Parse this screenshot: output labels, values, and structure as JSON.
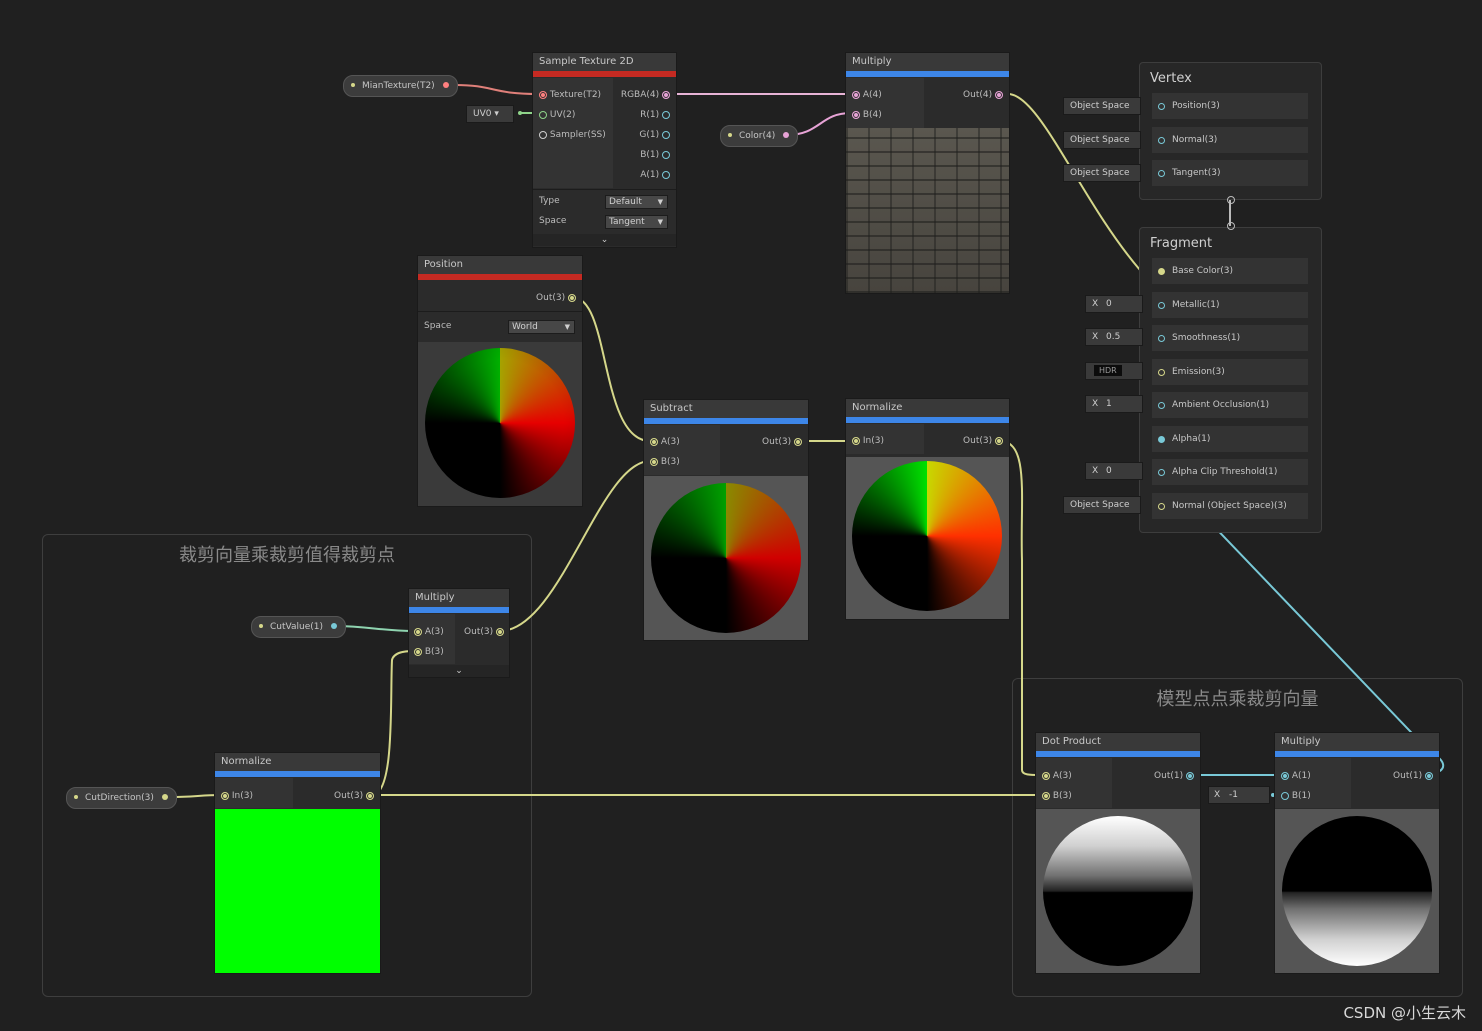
{
  "groups": [
    {
      "title": "裁剪向量乘裁剪值得裁剪点"
    },
    {
      "title": "模型点点乘裁剪向量"
    }
  ],
  "properties": {
    "main_texture": "MianTexture(T2)",
    "color": "Color(4)",
    "cut_value": "CutValue(1)",
    "cut_direction": "CutDirection(3)"
  },
  "uv_dropdown": "UV0",
  "sample_texture": {
    "title": "Sample Texture 2D",
    "inputs": [
      "Texture(T2)",
      "UV(2)",
      "Sampler(SS)"
    ],
    "outputs": [
      "RGBA(4)",
      "R(1)",
      "G(1)",
      "B(1)",
      "A(1)"
    ],
    "type_label": "Type",
    "type_value": "Default",
    "space_label": "Space",
    "space_value": "Tangent"
  },
  "multiply_top": {
    "title": "Multiply",
    "inputs": [
      "A(4)",
      "B(4)"
    ],
    "output": "Out(4)"
  },
  "position_node": {
    "title": "Position",
    "output": "Out(3)",
    "space_label": "Space",
    "space_value": "World"
  },
  "subtract_node": {
    "title": "Subtract",
    "inputs": [
      "A(3)",
      "B(3)"
    ],
    "output": "Out(3)"
  },
  "normalize_top": {
    "title": "Normalize",
    "input": "In(3)",
    "output": "Out(3)"
  },
  "multiply_cut": {
    "title": "Multiply",
    "inputs": [
      "A(3)",
      "B(3)"
    ],
    "output": "Out(3)"
  },
  "normalize_bottom": {
    "title": "Normalize",
    "input": "In(3)",
    "output": "Out(3)"
  },
  "dot_product": {
    "title": "Dot Product",
    "inputs": [
      "A(3)",
      "B(3)"
    ],
    "output": "Out(1)"
  },
  "multiply_bottom": {
    "title": "Multiply",
    "inputs": [
      "A(1)",
      "B(1)"
    ],
    "output": "Out(1)",
    "b_x": "X",
    "b_value": "-1"
  },
  "vertex": {
    "title": "Vertex",
    "ports": [
      "Position(3)",
      "Normal(3)",
      "Tangent(3)"
    ],
    "space_label": "Object Space"
  },
  "fragment": {
    "title": "Fragment",
    "ports": [
      "Base Color(3)",
      "Metallic(1)",
      "Smoothness(1)",
      "Emission(3)",
      "Ambient Occlusion(1)",
      "Alpha(1)",
      "Alpha Clip Threshold(1)",
      "Normal (Object Space)(3)"
    ],
    "metallic": "0",
    "smoothness": "0.5",
    "emission": "HDR",
    "ao": "1",
    "alpha_clip": "0",
    "x_label": "X",
    "normal_space": "Object Space"
  },
  "watermark": "CSDN @小生云木",
  "colors": {
    "accent_red": "#c52a22",
    "accent_blue": "#3d86e8",
    "wire_yellow": "#d5d78a",
    "wire_pink": "#e7a3d6",
    "wire_cyan": "#79c9d7"
  }
}
